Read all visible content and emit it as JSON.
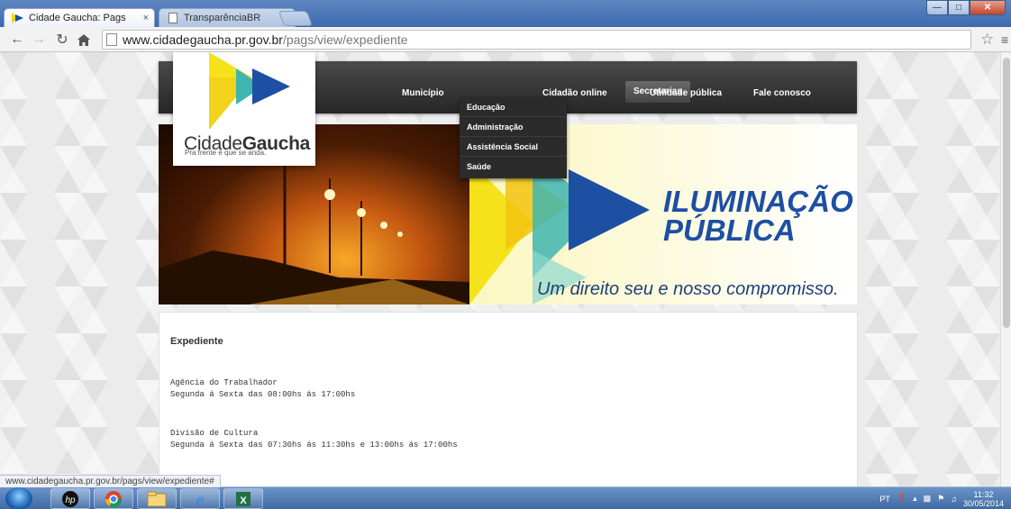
{
  "browser": {
    "tabs": [
      {
        "title": "Cidade Gaucha: Pags",
        "close": "×"
      },
      {
        "title": "TransparênciaBR",
        "close": "×"
      }
    ],
    "url_host": "www.cidadegaucha.pr.gov.br",
    "url_path": "/pags/view/expediente",
    "status_url": "www.cidadegaucha.pr.gov.br/pags/view/expediente#"
  },
  "site": {
    "logo": {
      "brand_light": "Cidade",
      "brand_bold": "Gaucha",
      "slogan": "Pra frente é que se anda."
    },
    "nav": {
      "municipio": "Município",
      "secretarias": "Secretarias",
      "cidadao": "Cidadão online",
      "utilidade": "Utilidade pública",
      "fale": "Fale conosco"
    },
    "dropdown": {
      "educacao": "Educação",
      "administracao": "Administração",
      "assistencia": "Assistência Social",
      "saude": "Saúde"
    },
    "banner": {
      "title_line1": "ILUMINAÇÃO",
      "title_line2": "PÚBLICA",
      "tagline": "Um direito seu e nosso compromisso."
    },
    "content": {
      "heading": "Expediente",
      "block1_line1": "Agência do Trabalhador",
      "block1_line2": "Segunda á Sexta das 08:00hs ás 17:00hs",
      "block2_line1": "Divisão de Cultura",
      "block2_line2": "Segunda á Sexta das 07:30hs ás 11:30hs e 13:00hs ás 17:00hs"
    }
  },
  "taskbar": {
    "lang": "PT",
    "time": "11:32",
    "date": "30/05/2014"
  },
  "colors": {
    "accent_blue": "#1d4fa3",
    "nav_dark": "#262626",
    "yellow": "#f6e21a",
    "teal": "#3fb5b0"
  }
}
